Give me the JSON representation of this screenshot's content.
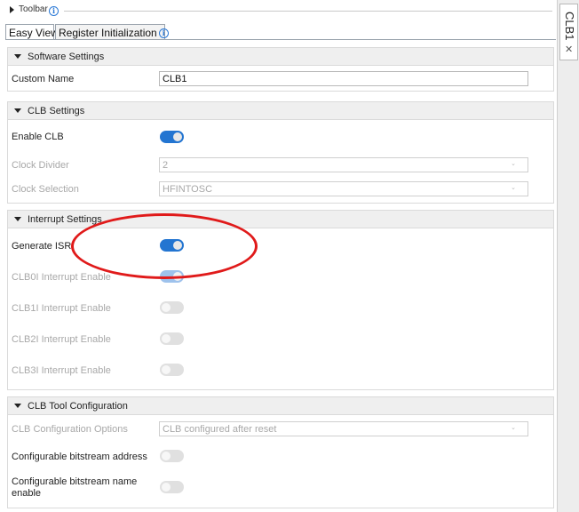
{
  "toolbar": {
    "label": "Toolbar"
  },
  "tabs": [
    {
      "label": "Easy View",
      "active": true
    },
    {
      "label": "Register Initialization",
      "active": false
    }
  ],
  "side_panel": {
    "tab_label": "CLB1",
    "close_label": "✕"
  },
  "sections": {
    "software": {
      "title": "Software Settings",
      "custom_name": {
        "label": "Custom Name",
        "value": "CLB1"
      }
    },
    "clb": {
      "title": "CLB Settings",
      "enable_clb": {
        "label": "Enable CLB",
        "on": true
      },
      "clock_divider": {
        "label": "Clock Divider",
        "value": "2"
      },
      "clock_selection": {
        "label": "Clock Selection",
        "value": "HFINTOSC"
      }
    },
    "interrupt": {
      "title": "Interrupt Settings",
      "generate_isr": {
        "label": "Generate ISR",
        "on": true
      },
      "clb0i": {
        "label": "CLB0I Interrupt Enable",
        "on": true
      },
      "clb1i": {
        "label": "CLB1I Interrupt Enable",
        "on": false
      },
      "clb2i": {
        "label": "CLB2I Interrupt Enable",
        "on": false
      },
      "clb3i": {
        "label": "CLB3I Interrupt Enable",
        "on": false
      }
    },
    "tool": {
      "title": "CLB Tool Configuration",
      "config_options": {
        "label": "CLB Configuration Options",
        "value": "CLB configured after reset"
      },
      "bitstream_address": {
        "label": "Configurable bitstream address",
        "on": false
      },
      "bitstream_name": {
        "label": "Configurable bitstream name enable",
        "on": false
      }
    }
  },
  "icons": {
    "info": "i",
    "chevron": "⌄"
  },
  "colors": {
    "toggle_on": "#2375d1",
    "annotation": "#e01a1a"
  }
}
